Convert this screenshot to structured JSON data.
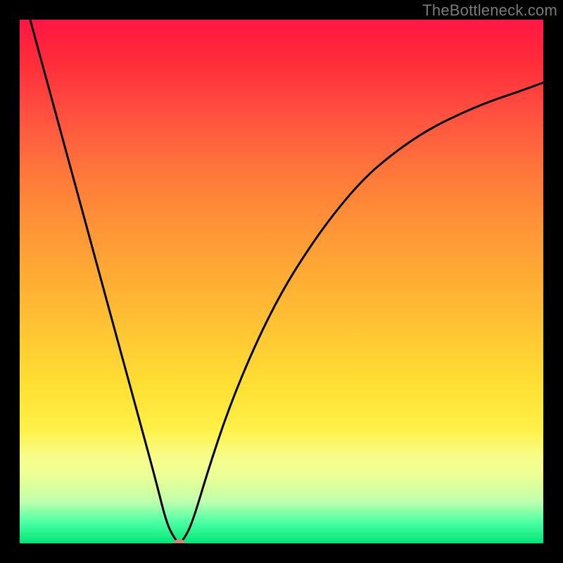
{
  "watermark": "TheBottleneck.com",
  "colors": {
    "background": "#000000",
    "gradient_top": "#ff1744",
    "gradient_mid": "#ffe033",
    "gradient_bottom": "#00e676",
    "curve": "#000000",
    "marker": "#c48a7a"
  },
  "chart_data": {
    "type": "line",
    "title": "",
    "xlabel": "",
    "ylabel": "",
    "xlim": [
      0,
      100
    ],
    "ylim": [
      0,
      100
    ],
    "grid": false,
    "legend": false,
    "series": [
      {
        "name": "bottleneck-curve",
        "x": [
          2,
          5,
          8,
          11,
          14,
          17,
          20,
          23,
          26,
          28,
          29.5,
          30.5,
          31.5,
          33,
          36,
          40,
          45,
          50,
          55,
          60,
          66,
          72,
          78,
          84,
          90,
          96,
          100
        ],
        "values": [
          100,
          89,
          78,
          67,
          56,
          45,
          34,
          23,
          12,
          4,
          1,
          0,
          1,
          4,
          14,
          26,
          38,
          48,
          56,
          63,
          70,
          75,
          79,
          82,
          84.5,
          86.5,
          88
        ]
      }
    ],
    "marker": {
      "x": 30.5,
      "y": 0,
      "color": "#c48a7a"
    },
    "background_gradient": {
      "direction": "vertical",
      "stops": [
        {
          "pos": 0.0,
          "color": "#ff1744"
        },
        {
          "pos": 0.3,
          "color": "#ff7a3a"
        },
        {
          "pos": 0.58,
          "color": "#ffc233"
        },
        {
          "pos": 0.8,
          "color": "#fff44c"
        },
        {
          "pos": 0.92,
          "color": "#bfffb0"
        },
        {
          "pos": 1.0,
          "color": "#00e676"
        }
      ]
    }
  }
}
